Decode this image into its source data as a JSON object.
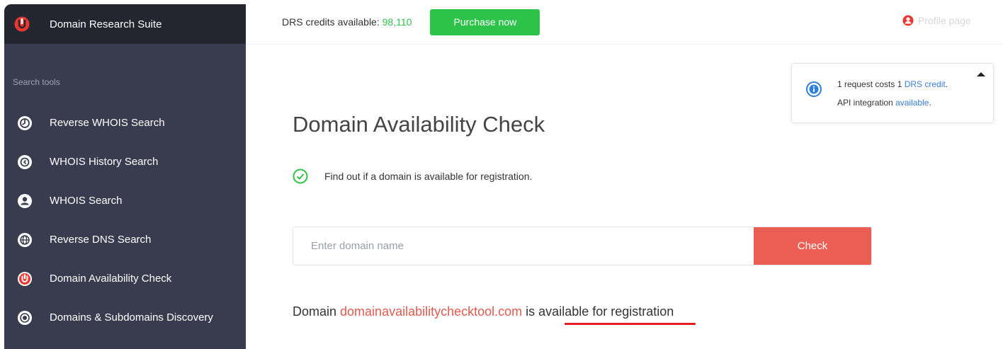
{
  "app": {
    "name": "Domain Research Suite"
  },
  "sidebar": {
    "section_label": "Search tools",
    "items": [
      {
        "label": "Reverse WHOIS Search",
        "icon": "reverse-whois-icon",
        "active": false
      },
      {
        "label": "WHOIS History Search",
        "icon": "history-icon",
        "active": false
      },
      {
        "label": "WHOIS Search",
        "icon": "user-circle-icon",
        "active": false
      },
      {
        "label": "Reverse DNS Search",
        "icon": "globe-icon",
        "active": false
      },
      {
        "label": "Domain Availability Check",
        "icon": "domain-availability-icon",
        "active": true
      },
      {
        "label": "Domains & Subdomains Discovery",
        "icon": "discovery-icon",
        "active": false
      }
    ]
  },
  "topbar": {
    "credits_label": "DRS credits available: ",
    "credits_value": "98,110",
    "purchase_label": "Purchase now",
    "user_name": "Profile page"
  },
  "info": {
    "line1_prefix": "1 request costs 1 ",
    "line1_link": "DRS credit",
    "line1_suffix": ".",
    "line2_prefix": "API integration ",
    "line2_link": "available",
    "line2_suffix": "."
  },
  "main": {
    "title": "Domain Availability Check",
    "description": "Find out if a domain is available for registration.",
    "input_placeholder": "Enter domain name",
    "input_value": "",
    "check_label": "Check",
    "result_prefix": "Domain ",
    "result_domain": "domainavailabilitychecktool.com",
    "result_is": " is ",
    "result_status": "available for registration"
  },
  "colors": {
    "sidebar_bg": "#393c4f",
    "brand_bg": "#23252f",
    "accent_green": "#2dc24a",
    "accent_red": "#eb5e53",
    "link_blue": "#3a7fd6",
    "underline_red": "#e31e24"
  }
}
